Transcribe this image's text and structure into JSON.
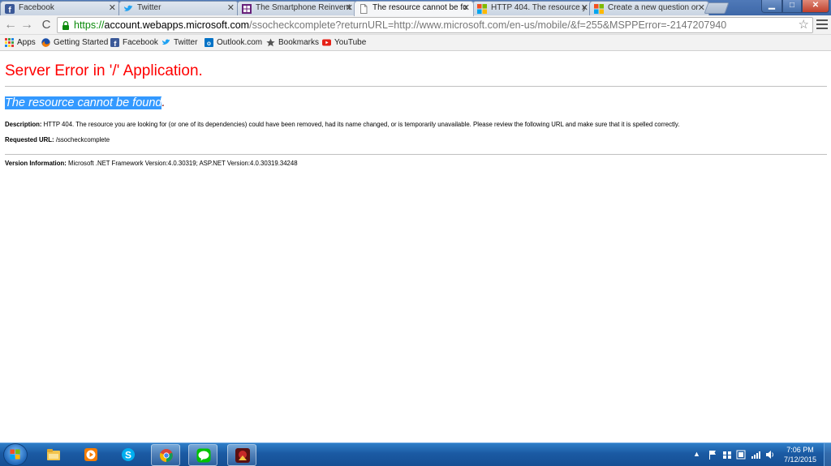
{
  "tabs": [
    {
      "label": "Facebook",
      "icon": "facebook-icon",
      "active": false
    },
    {
      "label": "Twitter",
      "icon": "twitter-icon",
      "active": false
    },
    {
      "label": "The Smartphone Reinvent",
      "icon": "windows-icon",
      "active": false
    },
    {
      "label": "The resource cannot be fo",
      "icon": "page-icon",
      "active": true
    },
    {
      "label": "HTTP 404. The resource y",
      "icon": "microsoft-icon",
      "active": false
    },
    {
      "label": "Create a new question or",
      "icon": "microsoft-icon",
      "active": false
    }
  ],
  "window_controls": {
    "minimize": "▁",
    "maximize": "□",
    "close": "✕"
  },
  "toolbar": {
    "back": "←",
    "forward": "→",
    "reload": "C",
    "url_scheme": "https://",
    "url_host": "account.webapps.microsoft.com",
    "url_path": "/ssocheckcomplete?returnURL=http://www.microsoft.com/en-us/mobile/&f=255&MSPPError=-2147207940",
    "star": "☆"
  },
  "bookmarks": [
    {
      "label": "Apps",
      "icon": "apps-grid-icon"
    },
    {
      "label": "Getting Started",
      "icon": "firefox-icon"
    },
    {
      "label": "Facebook",
      "icon": "facebook-icon"
    },
    {
      "label": "Twitter",
      "icon": "twitter-icon"
    },
    {
      "label": "Outlook.com",
      "icon": "outlook-icon"
    },
    {
      "label": "Bookmarks",
      "icon": "star-icon"
    },
    {
      "label": "YouTube",
      "icon": "youtube-icon"
    }
  ],
  "page": {
    "title": "Server Error in '/' Application.",
    "subtitle_selected": "The resource cannot be found",
    "subtitle_rest": ".",
    "description_label": "Description:",
    "description_text": "HTTP 404. The resource you are looking for (or one of its dependencies) could have been removed, had its name changed, or is temporarily unavailable.  Please review the following URL and make sure that it is spelled correctly.",
    "requested_url_label": "Requested URL:",
    "requested_url_value": "/ssocheckcomplete",
    "version_label": "Version Information:",
    "version_value": "Microsoft .NET Framework Version:4.0.30319; ASP.NET Version:4.0.30319.34248"
  },
  "taskbar": {
    "apps": [
      "file-explorer-icon",
      "media-player-icon",
      "skype-icon",
      "chrome-icon",
      "line-icon",
      "game-icon"
    ],
    "tray_arrow": "▲",
    "time": "7:06 PM",
    "date": "7/12/2015"
  },
  "colors": {
    "error_title": "#ff0000",
    "subtitle": "#800000",
    "selection": "#3399ff",
    "url_secure": "#0a8a0a"
  }
}
